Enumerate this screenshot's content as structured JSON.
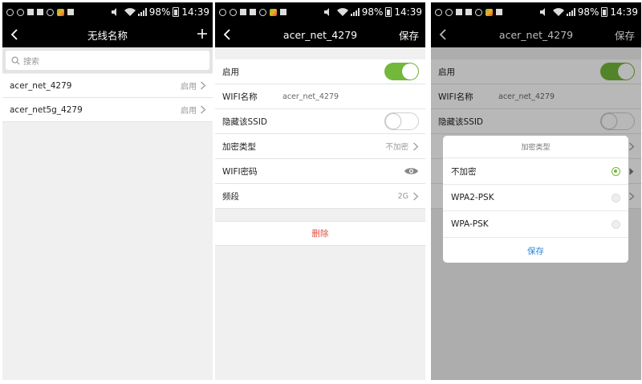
{
  "status_bar": {
    "battery": "98%",
    "time": "14:39"
  },
  "colors": {
    "accent_green": "#73b83a",
    "delete_red": "#e04e3e",
    "link_blue": "#2a86d8"
  },
  "screen1": {
    "title": "无线名称",
    "search_placeholder": "搜索",
    "networks": [
      {
        "ssid": "acer_net_4279",
        "state": "启用"
      },
      {
        "ssid": "acer_net5g_4279",
        "state": "启用"
      }
    ]
  },
  "screen2": {
    "title": "acer_net_4279",
    "save_label": "保存",
    "rows": {
      "enable_label": "启用",
      "enable_on": true,
      "wifi_name_label": "WIFI名称",
      "wifi_name_value": "acer_net_4279",
      "hide_ssid_label": "隐藏该SSID",
      "hide_ssid_on": false,
      "encryption_label": "加密类型",
      "encryption_value": "不加密",
      "password_label": "WIFI密码",
      "band_label": "频段",
      "band_value": "2G"
    },
    "delete_label": "删除"
  },
  "screen3": {
    "title": "acer_net_4279",
    "save_label": "保存",
    "rows": {
      "enable_label": "启用",
      "wifi_name_label": "WIFI名称",
      "wifi_name_value": "acer_net_4279",
      "hide_ssid_label": "隐藏该SSID"
    },
    "dialog": {
      "title": "加密类型",
      "options": [
        {
          "label": "不加密",
          "selected": true
        },
        {
          "label": "WPA2-PSK",
          "selected": false
        },
        {
          "label": "WPA-PSK",
          "selected": false
        }
      ],
      "save_label": "保存"
    }
  }
}
